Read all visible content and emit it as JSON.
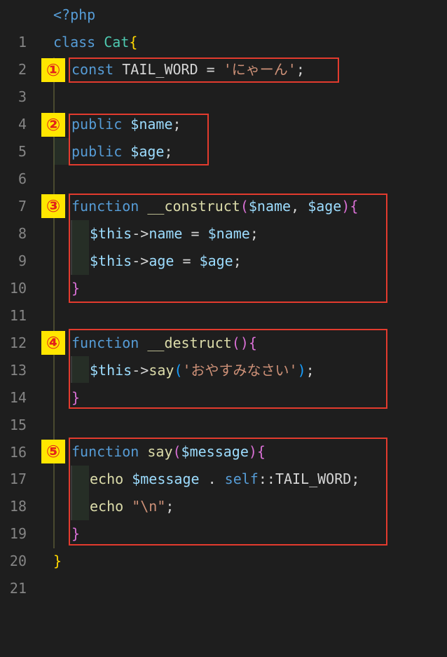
{
  "editor": {
    "line_numbers": [
      "1",
      "2",
      "3",
      "4",
      "5",
      "6",
      "7",
      "8",
      "9",
      "10",
      "11",
      "12",
      "13",
      "14",
      "15",
      "16",
      "17",
      "18",
      "19",
      "20",
      "21"
    ],
    "lines": {
      "l1": {
        "open_tag": "<?php"
      },
      "l2": {
        "kw": "class",
        "name": "Cat",
        "brace": "{"
      },
      "l3": {
        "kw": "const",
        "rest": " TAIL_WORD = ",
        "str": "'にゃーん'",
        "end": ";"
      },
      "l5": {
        "kw": "public",
        "var": "$name",
        "end": ";"
      },
      "l6": {
        "kw": "public",
        "var": "$age",
        "end": ";"
      },
      "l8": {
        "kw": "function",
        "name": "__construct",
        "open": "(",
        "p1": "$name",
        "comma": ", ",
        "p2": "$age",
        "close": ")",
        "brace": "{"
      },
      "l9": {
        "this": "$this",
        "arrow": "->",
        "prop": "name",
        "eq": " = ",
        "val": "$name",
        "end": ";"
      },
      "l10": {
        "this": "$this",
        "arrow": "->",
        "prop": "age",
        "eq": " = ",
        "val": "$age",
        "end": ";"
      },
      "l11": {
        "brace": "}"
      },
      "l13": {
        "kw": "function",
        "name": "__destruct",
        "parens": "()",
        "brace": "{"
      },
      "l14": {
        "this": "$this",
        "arrow": "->",
        "method": "say",
        "open": "(",
        "str": "'おやすみなさい'",
        "close": ")",
        "end": ";"
      },
      "l15": {
        "brace": "}"
      },
      "l17": {
        "kw": "function",
        "name": "say",
        "open": "(",
        "p1": "$message",
        "close": ")",
        "brace": "{"
      },
      "l18": {
        "kw": "echo",
        "var": " $message",
        "dot": " . ",
        "self": "self",
        "sep": "::",
        "const": "TAIL_WORD",
        "end": ";"
      },
      "l19": {
        "kw": "echo",
        "sp": " ",
        "str": "\"\\n\"",
        "end": ";"
      },
      "l20": {
        "brace": "}"
      },
      "l21": {
        "brace": "}"
      }
    }
  },
  "annotations": {
    "badges": [
      "①",
      "②",
      "③",
      "④",
      "⑤"
    ],
    "border_color": "#e33b2e",
    "badge_color": "#ffe600"
  }
}
